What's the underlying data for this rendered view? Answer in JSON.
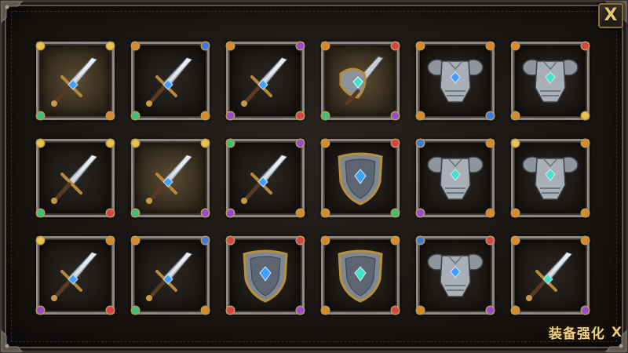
{
  "window": {
    "close_label": "X"
  },
  "footer": {
    "title": "装备强化",
    "close_label": "X"
  },
  "colors": {
    "gold": "#e6c873",
    "frame": "#8d8880",
    "gem_blue": "#3fa0ff",
    "gem_teal": "#3ee3c8"
  },
  "slots": [
    {
      "item": "sword",
      "gem": "blue",
      "highlight": true,
      "corners": [
        "yellow",
        "yellow",
        "green",
        "orange"
      ]
    },
    {
      "item": "sword",
      "gem": "blue",
      "highlight": false,
      "corners": [
        "orange",
        "blue",
        "green",
        "orange"
      ]
    },
    {
      "item": "sword",
      "gem": "blue",
      "highlight": false,
      "corners": [
        "orange",
        "purple",
        "purple",
        "red"
      ]
    },
    {
      "item": "sword-ornate",
      "gem": "teal",
      "highlight": true,
      "corners": [
        "orange",
        "red",
        "green",
        "purple"
      ]
    },
    {
      "item": "chest-armor",
      "gem": "blue",
      "highlight": false,
      "corners": [
        "orange",
        "orange",
        "orange",
        "blue"
      ]
    },
    {
      "item": "chest-armor",
      "gem": "teal",
      "highlight": false,
      "corners": [
        "orange",
        "red",
        "orange",
        "yellow"
      ]
    },
    {
      "item": "sword",
      "gem": "none",
      "highlight": false,
      "corners": [
        "yellow",
        "yellow",
        "green",
        "red"
      ]
    },
    {
      "item": "sword",
      "gem": "blue",
      "highlight": true,
      "corners": [
        "yellow",
        "yellow",
        "green",
        "purple"
      ]
    },
    {
      "item": "sword",
      "gem": "blue",
      "highlight": false,
      "corners": [
        "green",
        "purple",
        "purple",
        "orange"
      ]
    },
    {
      "item": "shield",
      "gem": "blue",
      "highlight": false,
      "corners": [
        "orange",
        "red",
        "orange",
        "green"
      ]
    },
    {
      "item": "chest-armor",
      "gem": "teal",
      "highlight": false,
      "corners": [
        "blue",
        "orange",
        "purple",
        "orange"
      ]
    },
    {
      "item": "chest-armor",
      "gem": "teal",
      "highlight": false,
      "corners": [
        "yellow",
        "orange",
        "orange",
        "orange"
      ]
    },
    {
      "item": "sword",
      "gem": "blue",
      "highlight": false,
      "corners": [
        "yellow",
        "orange",
        "purple",
        "red"
      ]
    },
    {
      "item": "sword",
      "gem": "blue",
      "highlight": false,
      "corners": [
        "orange",
        "blue",
        "green",
        "orange"
      ]
    },
    {
      "item": "shield",
      "gem": "blue",
      "highlight": false,
      "corners": [
        "red",
        "red",
        "red",
        "purple"
      ]
    },
    {
      "item": "shield",
      "gem": "teal",
      "highlight": false,
      "corners": [
        "orange",
        "orange",
        "orange",
        "red"
      ]
    },
    {
      "item": "chest-armor",
      "gem": "blue",
      "highlight": false,
      "corners": [
        "blue",
        "red",
        "orange",
        "purple"
      ]
    },
    {
      "item": "sword",
      "gem": "teal",
      "highlight": false,
      "corners": [
        "orange",
        "orange",
        "orange",
        "purple"
      ]
    }
  ]
}
